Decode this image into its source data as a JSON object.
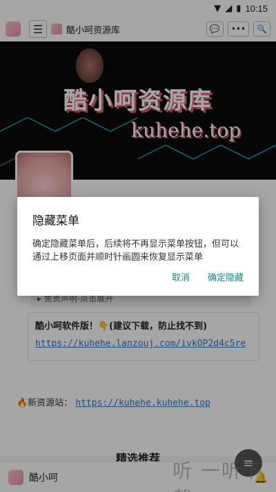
{
  "statusbar": {
    "time": "10:15"
  },
  "topbar": {
    "title": "酷小呵资源库",
    "menu_icon": "☰",
    "chat_icon": "💬",
    "more_icon": "•••",
    "search_icon": "🔍"
  },
  "banner": {
    "title": "酷小呵资源库",
    "url": "kuhehe.top"
  },
  "content": {
    "collapse_text": "▸ 免责声明-点击展开",
    "card_line1": "酷小呵软件版！👇(建议下载，防止找不到)",
    "card_link": "https://kuhehe.lanzouj.com/ivkOP2d4c5re",
    "newsite_label": "🔥新资源站：",
    "newsite_link": "https://kuhehe.kuhehe.top",
    "section_title": "精选推荐"
  },
  "bottombar": {
    "name": "酷小呵"
  },
  "watermark": "听 一听下载",
  "dialog": {
    "title": "隐藏菜单",
    "message": "确定隐藏菜单后，后续将不再显示菜单按钮，但可以通过上移页面并顺时针画圆来恢复显示菜单",
    "cancel": "取消",
    "confirm": "确定隐藏"
  }
}
